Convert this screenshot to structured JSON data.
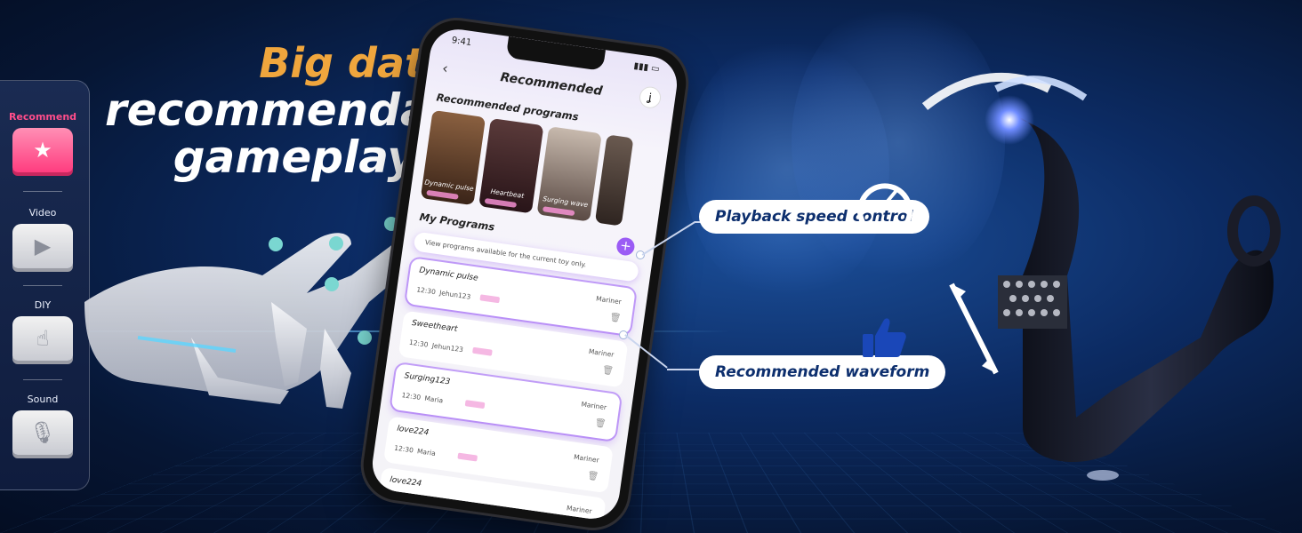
{
  "headline": {
    "line1": "Big data",
    "line2": "recommendation",
    "line3": "gameplay"
  },
  "sidebar": {
    "modes": [
      {
        "label": "Recommend",
        "active": true,
        "icon": "star-icon"
      },
      {
        "label": "Video",
        "active": false,
        "icon": "video-camera-icon"
      },
      {
        "label": "DIY",
        "active": false,
        "icon": "hand-touch-icon"
      },
      {
        "label": "Sound",
        "active": false,
        "icon": "microphone-icon"
      }
    ]
  },
  "phone": {
    "status_time": "9:41",
    "title": "Recommended",
    "recommended_section": "Recommended programs",
    "cards": [
      {
        "label": "Dynamic pulse",
        "color": "#5a3a2a"
      },
      {
        "label": "Heartbeat",
        "color": "#4a2f30"
      },
      {
        "label": "Surging wave",
        "color": "#7a6a60"
      }
    ],
    "my_programs_section": "My Programs",
    "hint": "View programs available for the current toy only.",
    "programs": [
      {
        "name": "Dynamic pulse",
        "time": "12:30",
        "author": "Jehun123",
        "toy": "Mariner"
      },
      {
        "name": "Sweetheart",
        "time": "12:30",
        "author": "Jehun123",
        "toy": "Mariner"
      },
      {
        "name": "Surging123",
        "time": "12:30",
        "author": "Maria",
        "toy": "Mariner"
      },
      {
        "name": "love224",
        "time": "12:30",
        "author": "Maria",
        "toy": "Mariner"
      },
      {
        "name": "love224",
        "time": "",
        "author": "",
        "toy": "Mariner"
      }
    ]
  },
  "callouts": {
    "speed": "Playback speed control",
    "waveform": "Recommended waveform"
  },
  "colors": {
    "accent_orange": "#f0a63d",
    "accent_pink": "#ff3d7f",
    "accent_purple": "#9b5cf5",
    "callout_text": "#0d2f6e"
  }
}
